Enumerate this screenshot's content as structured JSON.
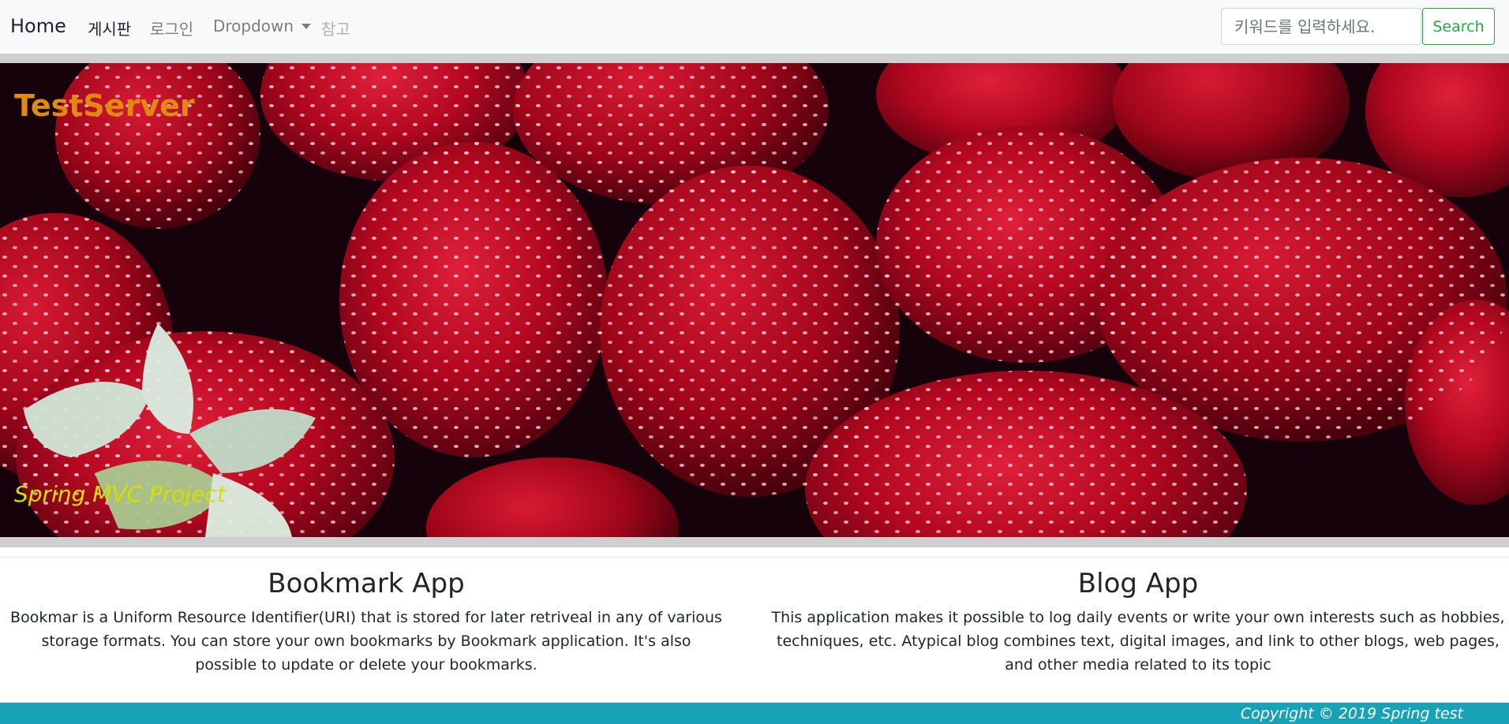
{
  "navbar": {
    "brand": "Home",
    "items": [
      {
        "label": "게시판"
      },
      {
        "label": "로그인"
      },
      {
        "label": "Dropdown"
      },
      {
        "label": "참고"
      }
    ],
    "search": {
      "placeholder": "키워드를 입력하세요.",
      "value": "",
      "button_label": "Search"
    }
  },
  "hero": {
    "title": "TestServer",
    "subtitle": "Spring MVC Project",
    "colors": {
      "title": "#e08a10",
      "subtitle": "#d6e000"
    }
  },
  "cards": [
    {
      "title": "Bookmark App",
      "text": "Bookmar is a Uniform Resource Identifier(URI) that is stored for later retriveal in any of various storage formats. You can store your own bookmarks by Bookmark application. It's also possible to update or delete your bookmarks."
    },
    {
      "title": "Blog App",
      "text": "This application makes it possible to log daily events or write your own interests such as hobbies, techniques, etc. Atypical blog combines text, digital images, and link to other blogs, web pages, and other media related to its topic"
    }
  ],
  "footer": {
    "copyright": "Copyright © 2019 Spring test",
    "color": "#17a2b8"
  },
  "theme": {
    "search_button": "#28a745"
  }
}
